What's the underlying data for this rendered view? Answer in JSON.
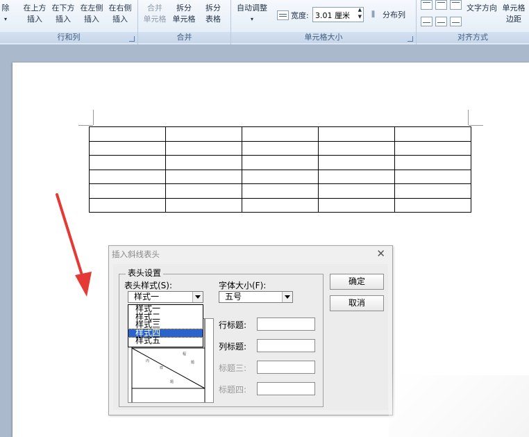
{
  "ribbon": {
    "groups": {
      "rows_cols": {
        "caption": "行和列",
        "buttons": [
          {
            "line1": "除",
            "line2": ""
          },
          {
            "line1": "在上方",
            "line2": "插入"
          },
          {
            "line1": "在下方",
            "line2": "插入"
          },
          {
            "line1": "在左侧",
            "line2": "插入"
          },
          {
            "line1": "在右侧",
            "line2": "插入"
          }
        ]
      },
      "merge": {
        "caption": "合并",
        "buttons": [
          {
            "line1": "合并",
            "line2": "单元格"
          },
          {
            "line1": "拆分",
            "line2": "单元格"
          },
          {
            "line1": "拆分",
            "line2": "表格"
          }
        ]
      },
      "cell_size": {
        "caption": "单元格大小",
        "autofit_label": "自动调整",
        "width_label": "宽度:",
        "width_value": "3.01 厘米",
        "distribute_cols_label": "分布列"
      },
      "alignment": {
        "caption": "对齐方式",
        "text_direction_label": "文字方向",
        "cell_margins_line1": "单元格",
        "cell_margins_line2": "边距"
      }
    }
  },
  "document": {
    "table": {
      "rows": 6,
      "cols": 5
    }
  },
  "dialog": {
    "title": "插入斜线表头",
    "group_label": "表头设置",
    "style_label": "表头样式(S):",
    "style_value": "样式一",
    "style_options": [
      "样式一",
      "样式二",
      "样式三",
      "样式四",
      "样式五"
    ],
    "style_highlighted_index": 3,
    "font_size_label": "字体大小(F):",
    "font_size_value": "五号",
    "row_title_label": "行标题:",
    "col_title_label": "列标题:",
    "title3_label": "标题三:",
    "title4_label": "标题四:",
    "ok_label": "确定",
    "cancel_label": "取消"
  },
  "colors": {
    "ribbon_bg": "#dfe9f5",
    "highlight": "#2a63c9",
    "arrow": "#e53935",
    "page_bg": "#aab9cc"
  }
}
